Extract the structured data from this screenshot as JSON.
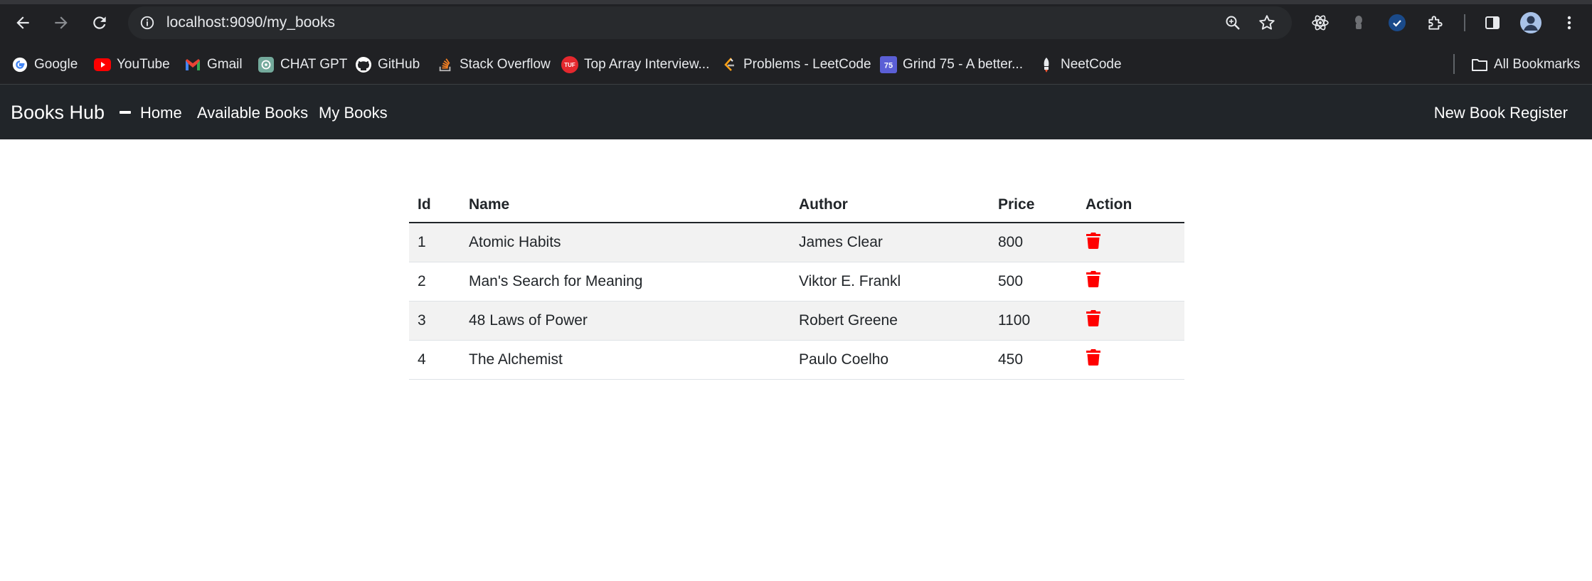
{
  "browser": {
    "url": "localhost:9090/my_books",
    "bookmarks": [
      {
        "label": "Google",
        "icon": "google-icon"
      },
      {
        "label": "YouTube",
        "icon": "youtube-icon"
      },
      {
        "label": "Gmail",
        "icon": "gmail-icon"
      },
      {
        "label": "CHAT GPT",
        "icon": "chatgpt-icon"
      },
      {
        "label": "GitHub",
        "icon": "github-icon"
      },
      {
        "label": "Stack Overflow",
        "icon": "stackoverflow-icon"
      },
      {
        "label": "Top Array Interview...",
        "icon": "tuf-icon"
      },
      {
        "label": "Problems - LeetCode",
        "icon": "leetcode-icon"
      },
      {
        "label": "Grind 75 - A better...",
        "icon": "grind75-icon"
      },
      {
        "label": "NeetCode",
        "icon": "neetcode-icon"
      }
    ],
    "all_bookmarks_label": "All Bookmarks",
    "grind75_badge": "75",
    "tuf_badge": "TUF"
  },
  "app": {
    "brand": "Books Hub",
    "nav": {
      "home": "Home",
      "available_books": "Available Books",
      "my_books": "My Books",
      "register": "New Book Register"
    }
  },
  "table": {
    "headers": {
      "id": "Id",
      "name": "Name",
      "author": "Author",
      "price": "Price",
      "action": "Action"
    },
    "rows": [
      {
        "id": "1",
        "name": "Atomic Habits",
        "author": "James Clear",
        "price": "800"
      },
      {
        "id": "2",
        "name": "Man's Search for Meaning",
        "author": "Viktor E. Frankl",
        "price": "500"
      },
      {
        "id": "3",
        "name": "48 Laws of Power",
        "author": "Robert Greene",
        "price": "1100"
      },
      {
        "id": "4",
        "name": "The Alchemist",
        "author": "Paulo Coelho",
        "price": "450"
      }
    ],
    "delete_icon": "trash-icon"
  },
  "colors": {
    "navbar_bg": "#212529",
    "delete_red": "#ff0000",
    "striped_row": "#f2f2f2",
    "chrome_bg": "#202124"
  }
}
